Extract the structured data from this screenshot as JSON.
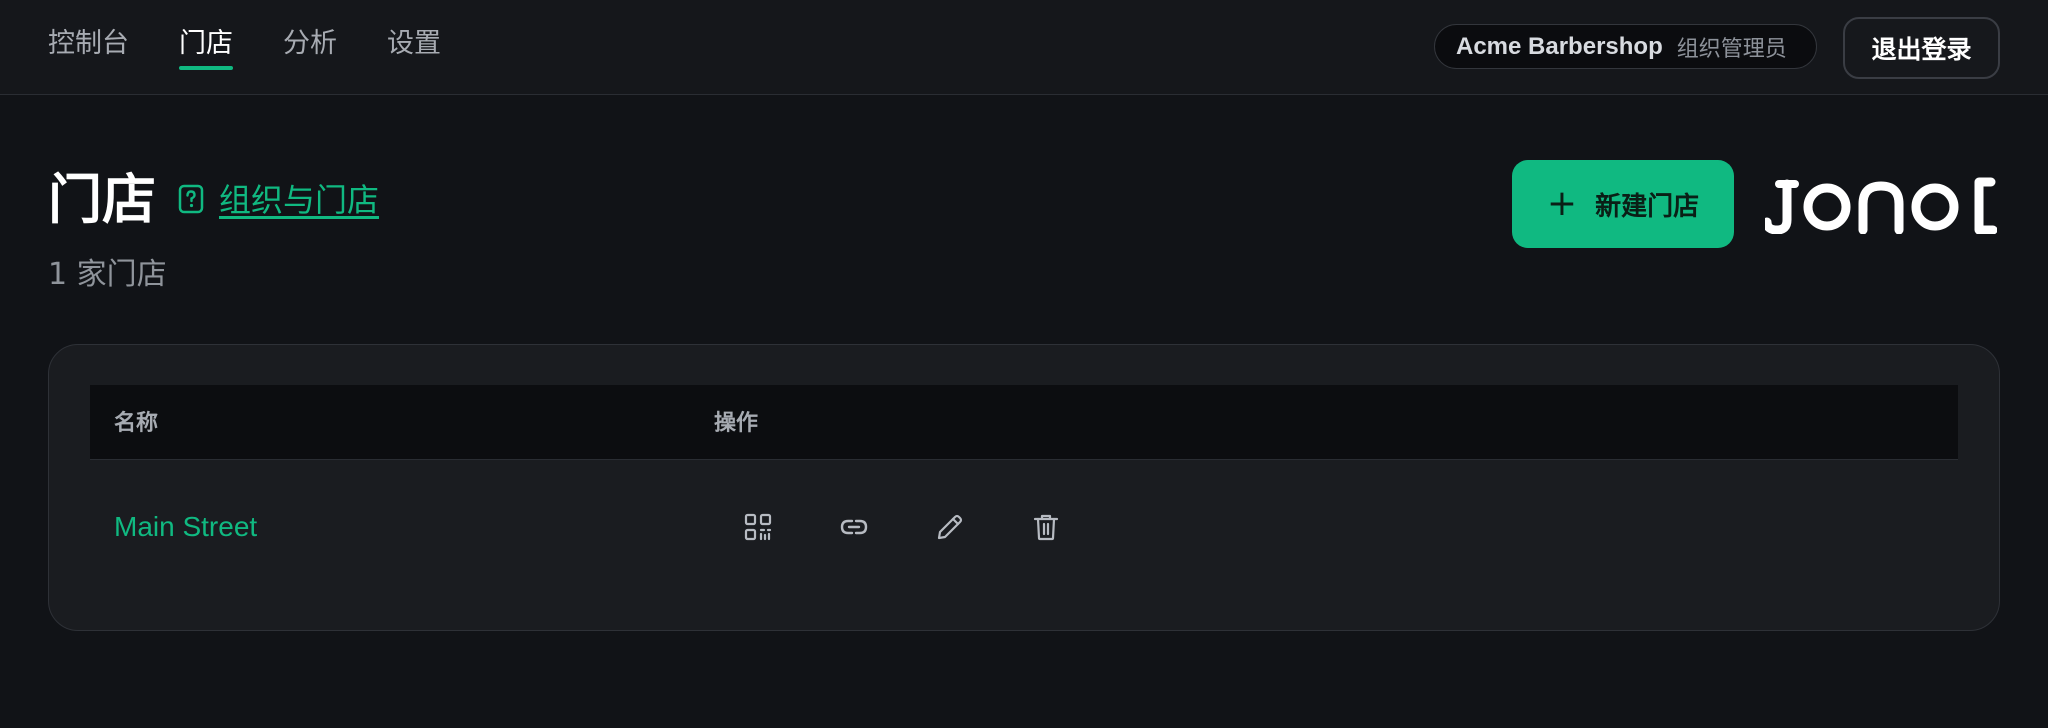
{
  "nav": {
    "tabs": [
      {
        "label": "控制台",
        "active": false
      },
      {
        "label": "门店",
        "active": true
      },
      {
        "label": "分析",
        "active": false
      },
      {
        "label": "设置",
        "active": false
      }
    ]
  },
  "org": {
    "name": "Acme Barbershop",
    "role": "组织管理员"
  },
  "logout_label": "退出登录",
  "page": {
    "title": "门店",
    "help_link": "组织与门店",
    "count_text": "1 家门店",
    "new_button_label": "新建门店",
    "logo_text": "JONOL"
  },
  "table": {
    "columns": [
      "名称",
      "操作"
    ],
    "rows": [
      {
        "name": "Main Street",
        "actions": [
          "qr-code-icon",
          "link-icon",
          "edit-icon",
          "delete-icon"
        ]
      }
    ]
  },
  "colors": {
    "accent": "#10b981",
    "background": "#111317",
    "card": "#1a1c20"
  }
}
